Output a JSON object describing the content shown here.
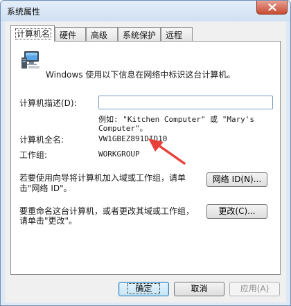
{
  "window": {
    "title": "系统属性",
    "close_label": "×"
  },
  "tabs": [
    {
      "label": "计算机名",
      "active": true
    },
    {
      "label": "硬件"
    },
    {
      "label": "高级"
    },
    {
      "label": "系统保护"
    },
    {
      "label": "远程"
    }
  ],
  "computer_name_tab": {
    "intro_text": "Windows 使用以下信息在网络中标识这台计算机。",
    "description_label": "计算机描述(D):",
    "description_value": "",
    "example_line1": "例如: \"Kitchen Computer\" 或 \"Mary's",
    "example_line2": "Computer\"。",
    "full_name_label": "计算机全名:",
    "full_name_value": "VW1GBEZ891DID10",
    "workgroup_label": "工作组:",
    "workgroup_value": "WORKGROUP",
    "network_id_text_line1": "若要使用向导将计算机加入域或工作组，请单",
    "network_id_text_line2": "击\"网络 ID\"。",
    "network_id_button": "网络 ID(N)...",
    "rename_text_line1": "要重命名这台计算机，或者更改其域或工作组，",
    "rename_text_line2": "请单击\"更改\"。",
    "change_button": "更改(C)..."
  },
  "footer": {
    "ok_button": "确定",
    "cancel_button": "取消",
    "apply_button": "应用(A)"
  },
  "colors": {
    "annotation_arrow": "#e8403a",
    "title_gradient_top": "#e4eef9",
    "close_button": "#c74a32"
  }
}
